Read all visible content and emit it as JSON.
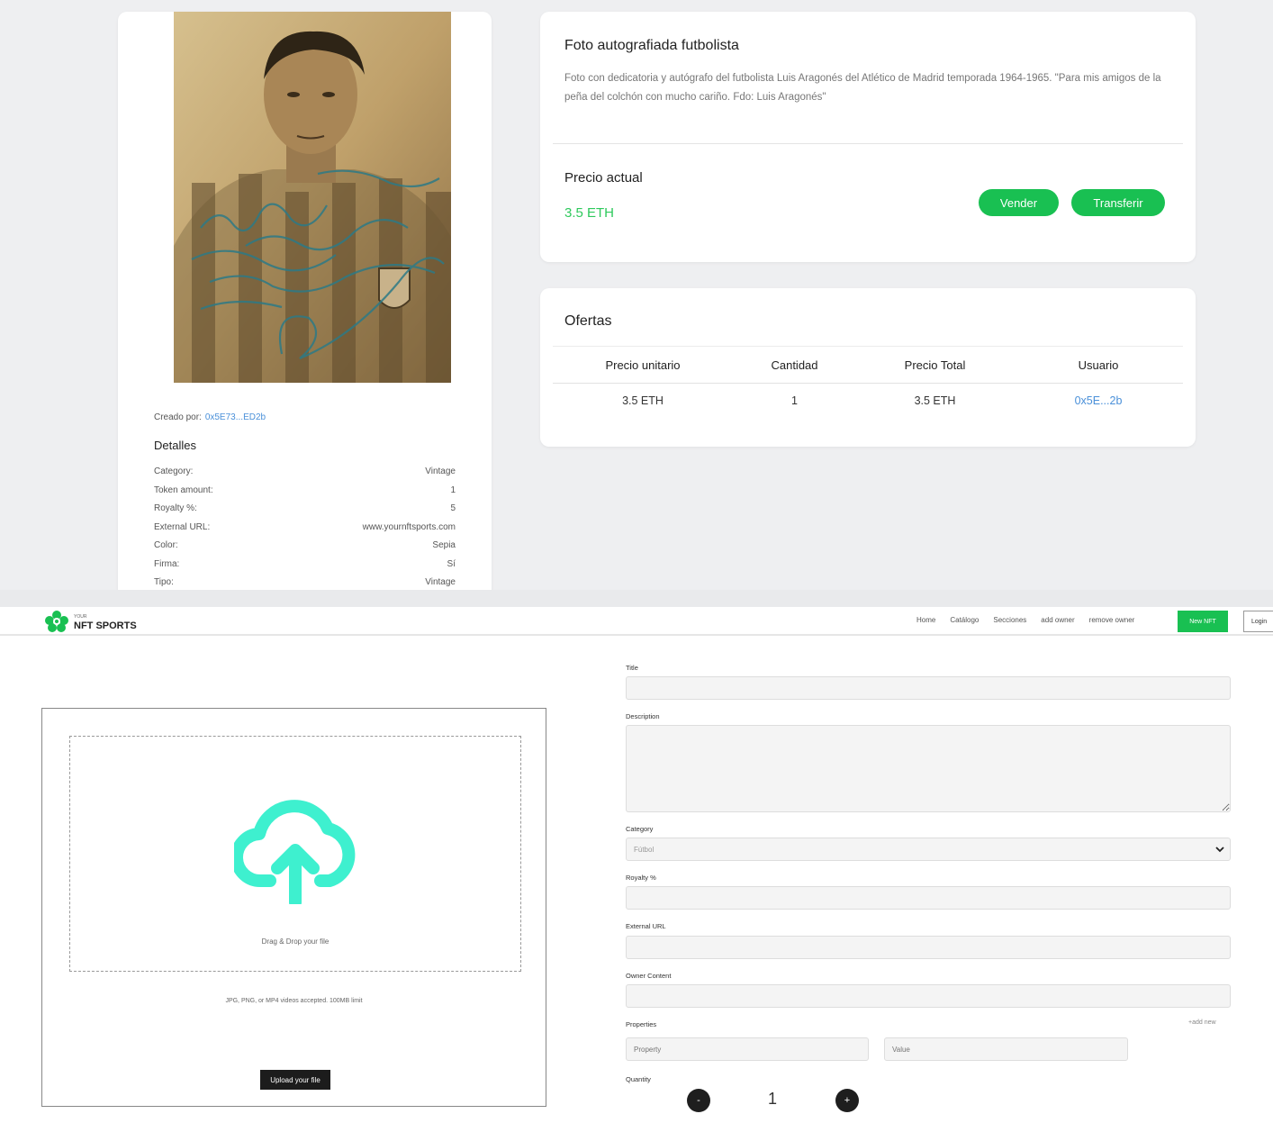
{
  "detail_page": {
    "creator": {
      "label": "Creado por:",
      "address": "0x5E73...ED2b"
    },
    "details_title": "Detalles",
    "details": [
      {
        "key": "Category:",
        "value": "Vintage"
      },
      {
        "key": "Token amount:",
        "value": "1"
      },
      {
        "key": "Royalty %:",
        "value": "5"
      },
      {
        "key": "External URL:",
        "value": "www.yournftsports.com"
      },
      {
        "key": "Color:",
        "value": "Sepia"
      },
      {
        "key": "Firma:",
        "value": "Sí"
      },
      {
        "key": "Tipo:",
        "value": "Vintage"
      }
    ],
    "item": {
      "title": "Foto autografiada futbolista",
      "description": "Foto con dedicatoria y autógrafo del futbolista Luis Aragonés del Atlético de Madrid temporada 1964-1965. \"Para mis amigos de la peña del colchón con mucho cariño. Fdo: Luis Aragonés\"",
      "price_label": "Precio actual",
      "price_value": "3.5 ETH",
      "sell_button": "Vender",
      "transfer_button": "Transferir"
    },
    "offers": {
      "title": "Ofertas",
      "columns": [
        "Precio unitario",
        "Cantidad",
        "Precio Total",
        "Usuario"
      ],
      "rows": [
        {
          "unit_price": "3.5 ETH",
          "quantity": "1",
          "total": "3.5 ETH",
          "user": "0x5E...2b"
        }
      ]
    }
  },
  "create_page": {
    "logo": {
      "small": "YOUR",
      "main": "NFT SPORTS"
    },
    "nav": [
      "Home",
      "Catálogo",
      "Secciones",
      "add owner",
      "remove owner"
    ],
    "new_nft_button": "New NFT",
    "login_button": "Login",
    "upload": {
      "drag_text": "Drag & Drop your file",
      "accept_text": "JPG, PNG, or MP4 videos accepted. 100MB limit",
      "button": "Upload your file"
    },
    "form": {
      "title_label": "Title",
      "description_label": "Description",
      "category_label": "Category",
      "category_value": "Fútbol",
      "royalty_label": "Royalty %",
      "external_url_label": "External URL",
      "owner_content_label": "Owner Content",
      "properties_label": "Properties",
      "add_new": "+add new",
      "property_placeholder": "Property",
      "value_placeholder": "Value",
      "quantity_label": "Quantity",
      "quantity_value": "1",
      "minus": "-",
      "plus": "+"
    }
  },
  "colors": {
    "accent_green": "#19c052",
    "link_blue": "#4a90d9",
    "upload_icon": "#3ef0cf"
  }
}
